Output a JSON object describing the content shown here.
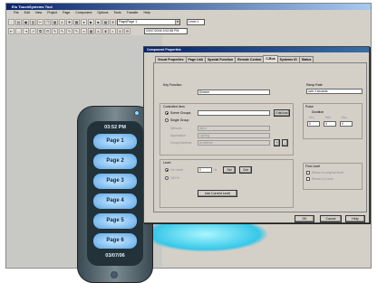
{
  "window_title": "Elo TouchSystems Tool",
  "menu": [
    "File",
    "Edit",
    "View",
    "Project",
    "Page",
    "Component",
    "Options",
    "Tools",
    "Transfer",
    "Help"
  ],
  "toolbar": {
    "page_combo": "Page|Page 1",
    "level_label": "Level 1",
    "datetime": "03/07/2006 3:52:58 PM"
  },
  "device": {
    "time": "03:52 PM",
    "date": "03/07/06",
    "pages": [
      "Page 1",
      "Page 2",
      "Page 3",
      "Page 4",
      "Page 5",
      "Page 6"
    ]
  },
  "dialog": {
    "title": "Component Properties",
    "tabs": [
      "Visual Properties",
      "Page Link",
      "Special Function",
      "Remote Control",
      "C-Bus",
      "Systems IO",
      "Status"
    ],
    "key_function": {
      "label": "Key Function",
      "value": "Dimmer"
    },
    "ramp_rate": {
      "label": "Ramp Rate",
      "value": "over 4 seconds"
    },
    "controlled_item": {
      "label": "Controlled Item",
      "scene_groups": "Scene Groups",
      "single_group": "Single Group",
      "edit_add": "Edit/Add"
    },
    "network": {
      "label": "Network",
      "value": "demo"
    },
    "application": {
      "label": "Application",
      "value": "Lighting"
    },
    "group_address": {
      "label": "Group Address",
      "value": "Undefined"
    },
    "pulse": {
      "label": "Pulse",
      "duration": "Duration",
      "units": [
        "Hrs",
        "Min",
        "Sec"
      ],
      "values": [
        "0",
        "0",
        "0"
      ]
    },
    "level": {
      "label": "Level",
      "on_level": "On Level",
      "value": "0",
      "units": "%",
      "set": "Set",
      "get": "Get",
      "percent_btn": "100 %",
      "use_current": "Use Current Level"
    },
    "find_level": {
      "label": "Find Level",
      "opt1": "Return to original level",
      "opt2": "Return to Level"
    },
    "buttons": {
      "ok": "OK",
      "cancel": "Cancel",
      "help": "Help"
    }
  }
}
